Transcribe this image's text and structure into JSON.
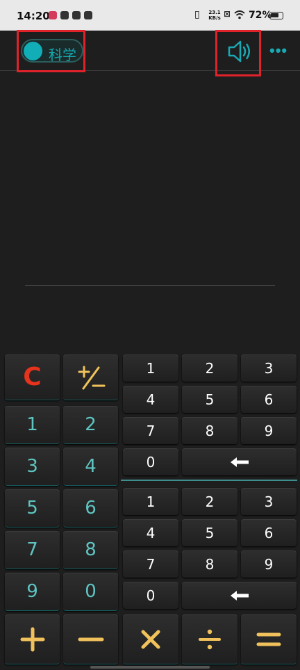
{
  "status_bar": {
    "time": "14:20",
    "net_speed_value": "23.1",
    "net_speed_unit": "KB/s",
    "vibrate_icon": "vibrate-icon",
    "sim_icon": "no-sim-icon",
    "wifi_icon": "wifi-icon",
    "battery_percent": "72%",
    "battery_level": 0.72
  },
  "header": {
    "mode_label": "科学",
    "speaker_icon": "speaker-icon",
    "more_label": "•••",
    "accent_color": "#11aeb8",
    "highlight_color": "#e0232b"
  },
  "left_keypad": {
    "clear": "C",
    "sign_toggle": "+⁄−",
    "digits": [
      "1",
      "2",
      "3",
      "4",
      "5",
      "6",
      "7",
      "8",
      "9",
      "0"
    ]
  },
  "upper_number_pad": {
    "digits": [
      "1",
      "2",
      "3",
      "4",
      "5",
      "6",
      "7",
      "8",
      "9",
      "0"
    ],
    "backspace": "🠐"
  },
  "lower_number_pad": {
    "digits": [
      "1",
      "2",
      "3",
      "4",
      "5",
      "6",
      "7",
      "8",
      "9",
      "0"
    ],
    "backspace": "🠐"
  },
  "operators": {
    "add": "+",
    "subtract": "−",
    "multiply": "×",
    "divide": "÷",
    "equals": "="
  }
}
